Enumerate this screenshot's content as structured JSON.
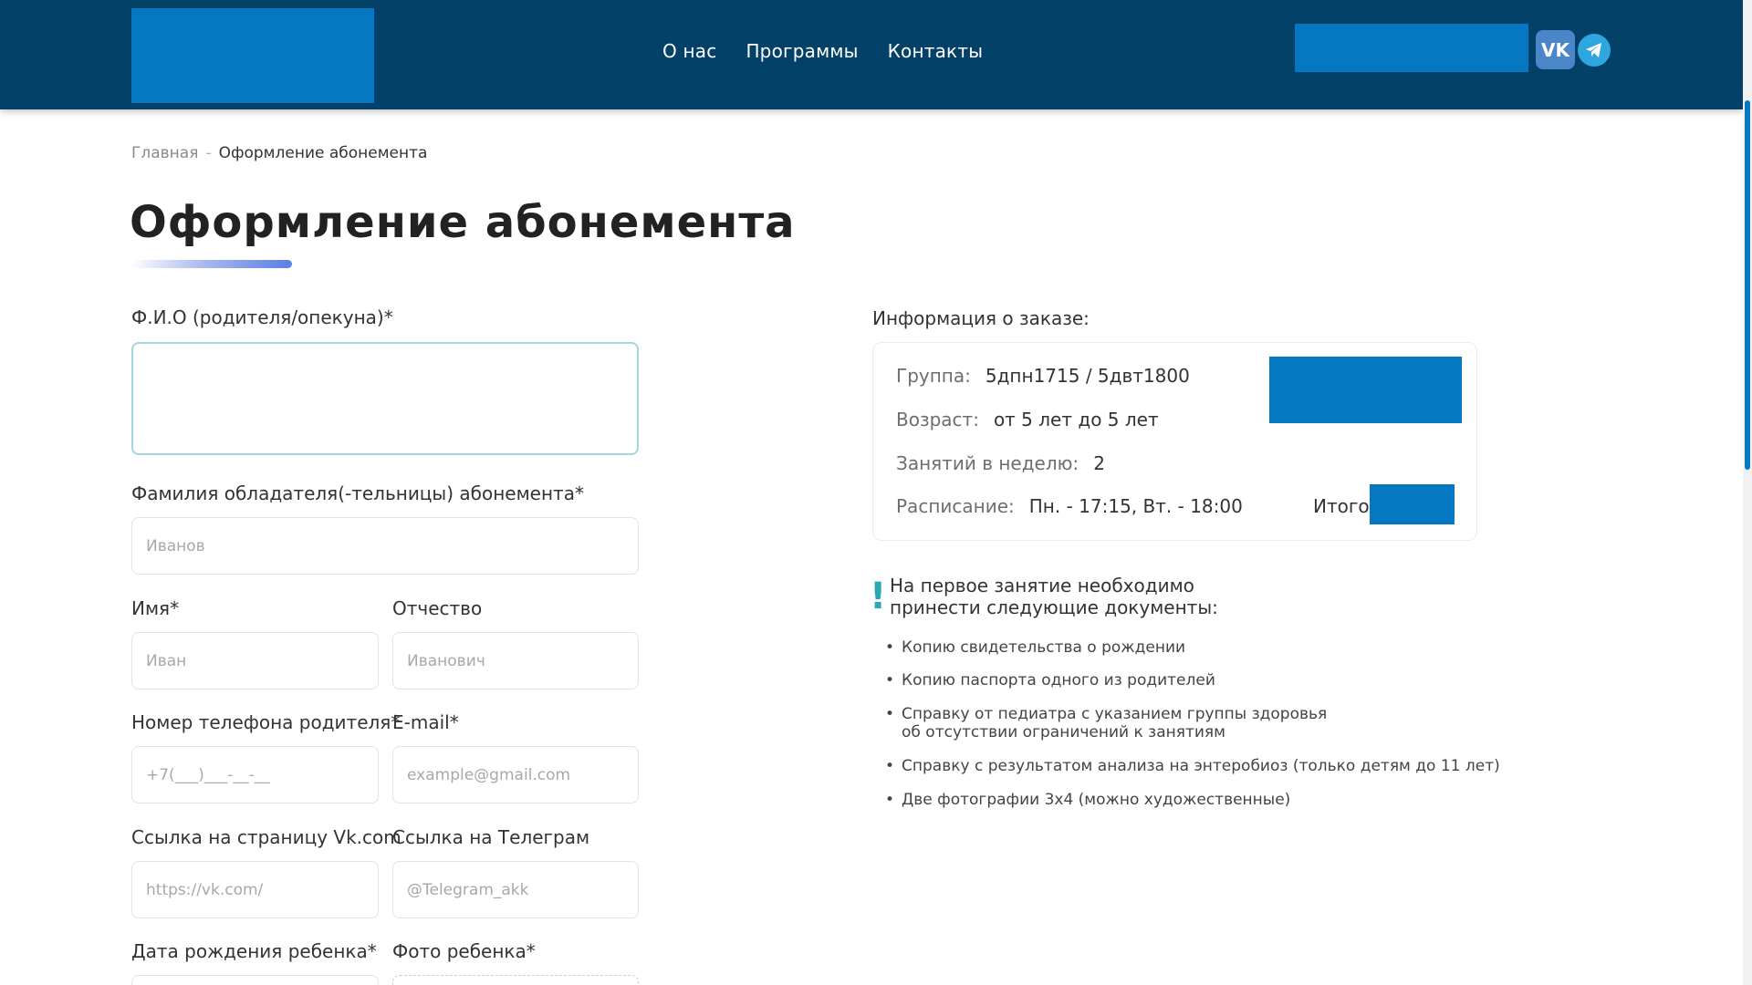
{
  "header": {
    "nav": [
      "О нас",
      "Программы",
      "Контакты"
    ],
    "vk_label": "VK"
  },
  "breadcrumb": {
    "home": "Главная",
    "separator": "-",
    "current": "Оформление абонемента"
  },
  "page_title": "Оформление абонемента",
  "form": {
    "guardian_name_label": "Ф.И.О (родителя/опекуна)*",
    "guardian_name_value": "",
    "surname_label": "Фамилия обладателя(-тельницы) абонемента*",
    "surname_placeholder": "Иванов",
    "first_name_label": "Имя*",
    "first_name_placeholder": "Иван",
    "patronymic_label": "Отчество",
    "patronymic_placeholder": "Иванович",
    "phone_label": "Номер телефона родителя*",
    "phone_placeholder": "+7(___)___-__-__",
    "email_label": "E-mail*",
    "email_placeholder": "example@gmail.com",
    "vk_label": "Ссылка на страницу Vk.com",
    "vk_placeholder": "https://vk.com/",
    "telegram_label": "Ссылка на Телеграм",
    "telegram_placeholder": "@Telegram_akk",
    "birthdate_label": "Дата рождения ребенка*",
    "photo_label": "Фото ребенка*"
  },
  "order_info": {
    "title": "Информация о заказе:",
    "group_key": "Группа:",
    "group_value": "5дпн1715 / 5двт1800",
    "age_key": "Возраст:",
    "age_value": "от 5 лет до 5 лет",
    "per_week_key": "Занятий в неделю:",
    "per_week_value": "2",
    "schedule_key": "Расписание:",
    "schedule_value": "Пн. - 17:15, Вт. - 18:00",
    "total_label": "Итого:"
  },
  "notice": {
    "mark": "!",
    "text": "На первое занятие необходимо принести следующие документы:",
    "documents": [
      "Копию свидетельства о рождении",
      "Копию паспорта одного из родителей",
      "Справку от педиатра с указанием группы здоровья",
      "об отсутствии ограничений к занятиям",
      "Справку с результатом анализа на энтеробиоз (только детям до 11 лет)",
      "Две фотографии 3х4 (можно художественные)"
    ]
  },
  "colors": {
    "header_bg": "#044169",
    "accent_blue": "#0677c1",
    "notice_mark": "#2aa8b5"
  }
}
